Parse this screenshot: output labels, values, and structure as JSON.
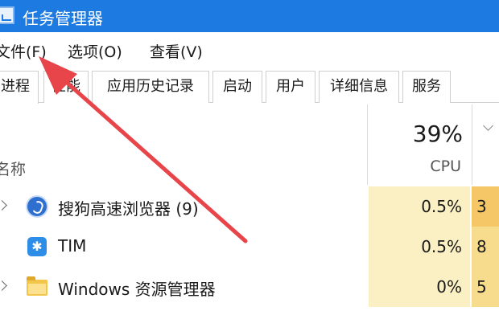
{
  "window": {
    "title": "任务管理器"
  },
  "menu": {
    "file": "文件(F)",
    "options": "选项(O)",
    "view": "查看(V)"
  },
  "tabs": [
    {
      "label": "进程"
    },
    {
      "label": "性能"
    },
    {
      "label": "应用历史记录"
    },
    {
      "label": "启动"
    },
    {
      "label": "用户"
    },
    {
      "label": "详细信息"
    },
    {
      "label": "服务"
    }
  ],
  "columns": {
    "name_header": "名称",
    "cpu": {
      "percent": "39%",
      "label": "CPU"
    }
  },
  "processes": [
    {
      "name": "搜狗高速浏览器 (9)",
      "cpu": "0.5%",
      "mem": "3",
      "icon": "sogou-browser-icon",
      "expandable": true
    },
    {
      "name": "TIM",
      "cpu": "0.5%",
      "mem": "8",
      "icon": "tim-icon",
      "expandable": false
    },
    {
      "name": "Windows 资源管理器",
      "cpu": "0%",
      "mem": "5",
      "icon": "folder-icon",
      "expandable": true
    }
  ],
  "colors": {
    "titlebar": "#1c7ae0",
    "cpu_cell": "#fbf0c3",
    "mem_cell": "#f7dc8e",
    "annotation_arrow": "#e8454a"
  }
}
